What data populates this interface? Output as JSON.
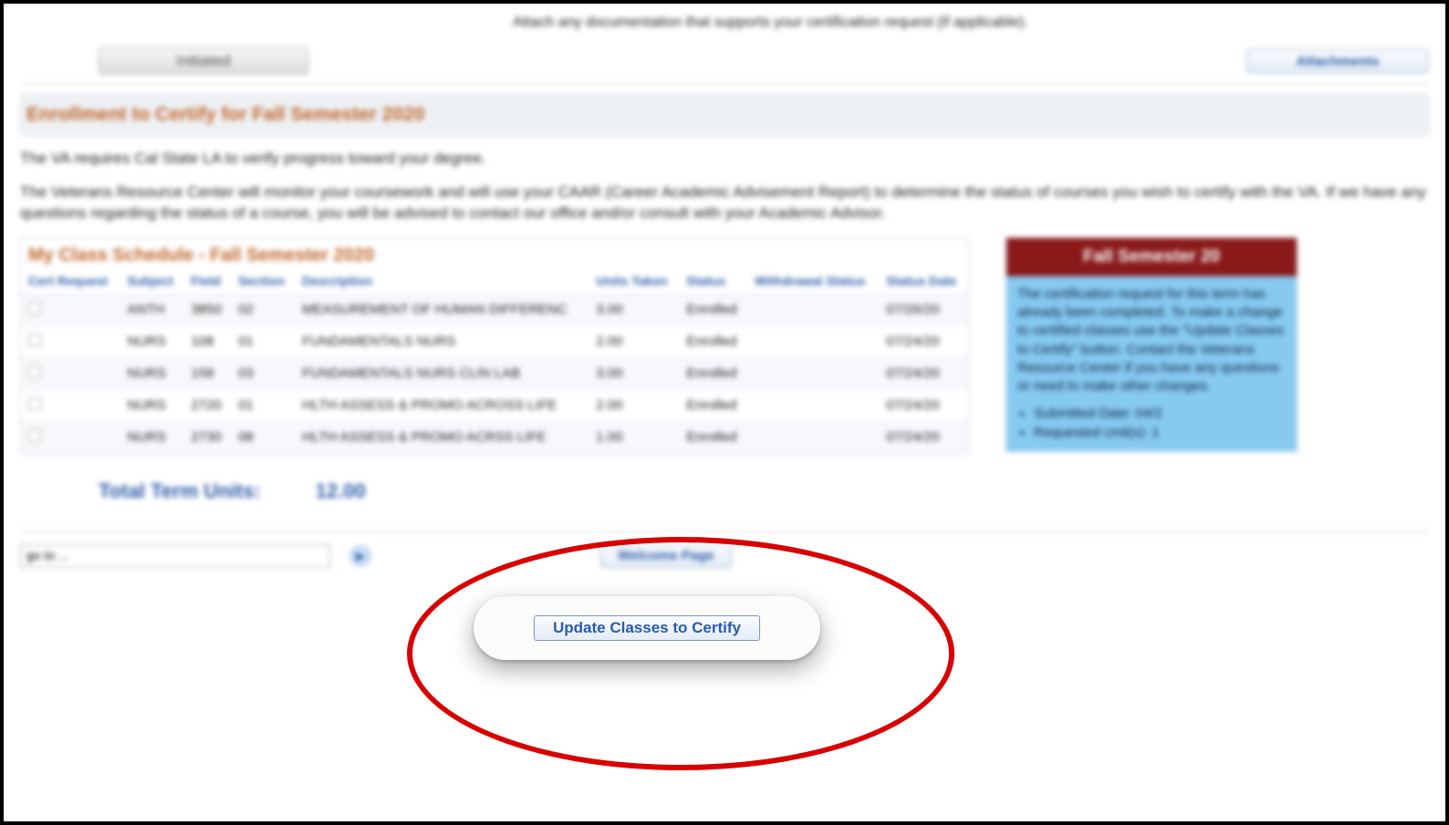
{
  "top": {
    "status_label": "Initiated",
    "attach_note": "Attach any documentation that supports your certification request (if applicable).",
    "attach_button": "Attachments"
  },
  "section": {
    "heading": "Enrollment to Certify for Fall Semester 2020",
    "para1": "The VA requires Cal State LA to verify progress toward your degree.",
    "para2": "The Veterans Resource Center will monitor your coursework and will use your CAAR (Career Academic Advisement Report) to determine the status of courses you wish to certify with the VA. If we have any questions regarding the status of a course, you will be advised to contact our office and/or consult with your Academic Advisor."
  },
  "schedule": {
    "title": "My Class Schedule - Fall Semester 2020",
    "headers": {
      "cert": "Cert Request",
      "subject": "Subject",
      "field": "Field",
      "section": "Section",
      "description": "Description",
      "units": "Units Taken",
      "status": "Status",
      "withdrawal": "Withdrawal Status",
      "status_date": "Status Date"
    },
    "rows": [
      {
        "subject": "ANTH",
        "field": "3850",
        "section": "02",
        "desc": "MEASUREMENT OF HUMAN DIFFERENC",
        "units": "3.00",
        "status": "Enrolled",
        "wd": "",
        "date": "07/26/20"
      },
      {
        "subject": "NURS",
        "field": "108",
        "section": "01",
        "desc": "FUNDAMENTALS NURS",
        "units": "2.00",
        "status": "Enrolled",
        "wd": "",
        "date": "07/24/20"
      },
      {
        "subject": "NURS",
        "field": "158",
        "section": "03",
        "desc": "FUNDAMENTALS NURS CLIN LAB",
        "units": "3.00",
        "status": "Enrolled",
        "wd": "",
        "date": "07/24/20"
      },
      {
        "subject": "NURS",
        "field": "2720",
        "section": "01",
        "desc": "HLTH ASSESS & PROMO ACROSS LIFE",
        "units": "2.00",
        "status": "Enrolled",
        "wd": "",
        "date": "07/24/20"
      },
      {
        "subject": "NURS",
        "field": "2730",
        "section": "08",
        "desc": "HLTH ASSESS & PROMO ACRSS LIFE",
        "units": "1.00",
        "status": "Enrolled",
        "wd": "",
        "date": "07/24/20"
      }
    ]
  },
  "side": {
    "head": "Fall Semester 20",
    "body_main": "The certification request for this term has already been completed. To make a change to certified classes use the \"Update Classes to Certify\" button. Contact the Veterans Resource Center if you have any questions or need to make other changes.",
    "bullets": [
      "Submitted Date: 04/2",
      "Requested Unit(s): 1"
    ]
  },
  "totals": {
    "label": "Total Term Units:",
    "value": "12.00"
  },
  "update_button": "Update Classes to Certify",
  "footer": {
    "dropdown": "go to ...",
    "welcome": "Welcome Page"
  }
}
